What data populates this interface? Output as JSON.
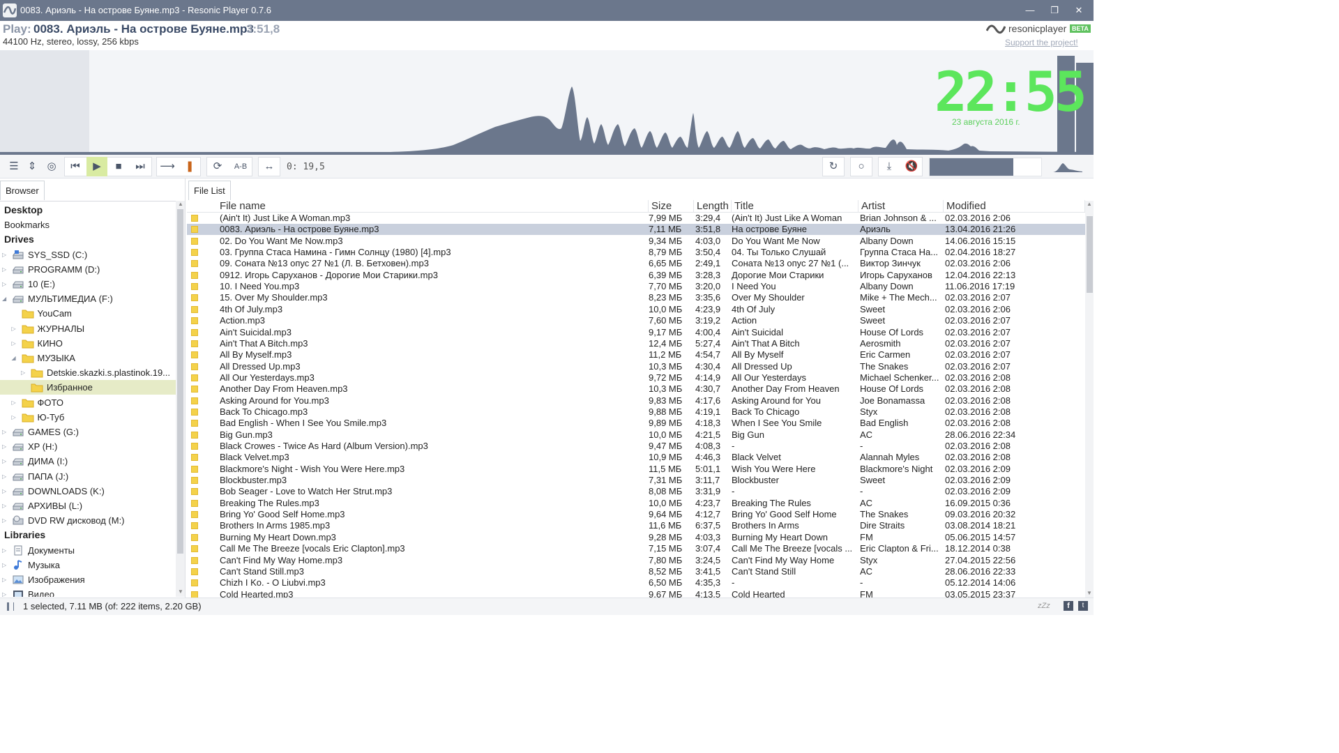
{
  "window": {
    "title": "0083. Ариэль - На острове Буяне.mp3 - Resonic Player 0.7.6",
    "min_icon": "minimize-icon",
    "max_icon": "maximize-icon",
    "close_icon": "close-icon"
  },
  "now_playing": {
    "play_label": "Play:",
    "title": "0083. Ариэль - На острове Буяне.mp3",
    "time": "3:51,8",
    "info": "44100 Hz, stereo, lossy, 256 kbps"
  },
  "brand": {
    "name": "resonicplayer",
    "beta": "BETA",
    "support": "Support the project!"
  },
  "clock": {
    "time": "22:55",
    "date": "23 августа 2016 г."
  },
  "toolbar": {
    "position_readout": "0: 19,5",
    "ab_label": "A-B",
    "volume_level": 0.75,
    "accent": "#d9eba2"
  },
  "browser": {
    "tab": "Browser",
    "tree": [
      {
        "label": "Desktop",
        "type": "section"
      },
      {
        "label": "Bookmarks",
        "type": "plain"
      },
      {
        "label": "Drives",
        "type": "section"
      },
      {
        "label": "SYS_SSD (C:)",
        "type": "drive",
        "depth": 0,
        "arrow": "right",
        "icon": "ssd-drive-icon"
      },
      {
        "label": "PROGRAMM (D:)",
        "type": "drive",
        "depth": 0,
        "arrow": "right",
        "icon": "hard-drive-icon"
      },
      {
        "label": "10 (E:)",
        "type": "drive",
        "depth": 0,
        "arrow": "right",
        "icon": "hard-drive-icon"
      },
      {
        "label": "МУЛЬТИМЕДИА (F:)",
        "type": "drive",
        "depth": 0,
        "arrow": "down",
        "icon": "hard-drive-icon"
      },
      {
        "label": "YouCam",
        "type": "folder",
        "depth": 1,
        "arrow": "",
        "icon": "folder-icon"
      },
      {
        "label": "ЖУРНАЛЫ",
        "type": "folder",
        "depth": 1,
        "arrow": "right",
        "icon": "folder-icon"
      },
      {
        "label": "КИНО",
        "type": "folder",
        "depth": 1,
        "arrow": "right",
        "icon": "folder-icon"
      },
      {
        "label": "МУЗЫКА",
        "type": "folder",
        "depth": 1,
        "arrow": "down",
        "icon": "folder-icon"
      },
      {
        "label": "Detskie.skazki.s.plastinok.19...",
        "type": "folder",
        "depth": 2,
        "arrow": "right",
        "icon": "folder-icon"
      },
      {
        "label": "Избранное",
        "type": "folder",
        "depth": 2,
        "arrow": "",
        "icon": "folder-icon",
        "selected": true
      },
      {
        "label": "ФОТО",
        "type": "folder",
        "depth": 1,
        "arrow": "right",
        "icon": "folder-icon"
      },
      {
        "label": "Ю-Туб",
        "type": "folder",
        "depth": 1,
        "arrow": "right",
        "icon": "folder-icon"
      },
      {
        "label": "GAMES (G:)",
        "type": "drive",
        "depth": 0,
        "arrow": "right",
        "icon": "hard-drive-icon"
      },
      {
        "label": "XP (H:)",
        "type": "drive",
        "depth": 0,
        "arrow": "right",
        "icon": "hard-drive-icon"
      },
      {
        "label": "ДИМА (I:)",
        "type": "drive",
        "depth": 0,
        "arrow": "right",
        "icon": "hard-drive-icon"
      },
      {
        "label": "ПАПА (J:)",
        "type": "drive",
        "depth": 0,
        "arrow": "right",
        "icon": "hard-drive-icon"
      },
      {
        "label": "DOWNLOADS (K:)",
        "type": "drive",
        "depth": 0,
        "arrow": "right",
        "icon": "hard-drive-icon"
      },
      {
        "label": "АРХИВЫ (L:)",
        "type": "drive",
        "depth": 0,
        "arrow": "right",
        "icon": "hard-drive-icon"
      },
      {
        "label": "DVD RW дисковод (M:)",
        "type": "drive",
        "depth": 0,
        "arrow": "right",
        "icon": "dvd-drive-icon"
      },
      {
        "label": "Libraries",
        "type": "section"
      },
      {
        "label": "Документы",
        "type": "drive",
        "depth": 0,
        "arrow": "right",
        "icon": "documents-icon"
      },
      {
        "label": "Музыка",
        "type": "drive",
        "depth": 0,
        "arrow": "right",
        "icon": "music-library-icon"
      },
      {
        "label": "Изображения",
        "type": "drive",
        "depth": 0,
        "arrow": "right",
        "icon": "pictures-icon"
      },
      {
        "label": "Видео",
        "type": "drive",
        "depth": 0,
        "arrow": "right",
        "icon": "video-library-icon"
      }
    ]
  },
  "filelist": {
    "tab": "File List",
    "columns": [
      "File name",
      "Size",
      "Length",
      "Title",
      "Artist",
      "Modified"
    ],
    "rows": [
      [
        "(Ain't It) Just Like A Woman.mp3",
        "7,99 МБ",
        "3:29,4",
        "(Ain't It) Just Like A Woman",
        "Brian Johnson & ...",
        "02.03.2016 2:06"
      ],
      [
        "0083. Ариэль - На острове Буяне.mp3",
        "7,11 МБ",
        "3:51,8",
        "На острове Буяне",
        "Ариэль",
        "13.04.2016 21:26"
      ],
      [
        "02. Do You Want Me Now.mp3",
        "9,34 МБ",
        "4:03,0",
        "Do You Want Me Now",
        "Albany Down",
        "14.06.2016 15:15"
      ],
      [
        "03. Группа Стаса Намина - Гимн Солнцу (1980) [4].mp3",
        "8,79 МБ",
        "3:50,4",
        "04. Ты Только Слушай",
        "Группа Стаса На...",
        "02.04.2016 18:27"
      ],
      [
        "09. Соната №13 опус 27 №1 (Л. В. Бетховен).mp3",
        "6,65 МБ",
        "2:49,1",
        "Соната №13 опус 27 №1 (...",
        "Виктор Зинчук",
        "02.03.2016 2:06"
      ],
      [
        "0912. Игорь Саруханов - Дорогие Мои Старики.mp3",
        "6,39 МБ",
        "3:28,3",
        "Дорогие Мои Старики",
        "Игорь Саруханов",
        "12.04.2016 22:13"
      ],
      [
        "10. I Need You.mp3",
        "7,70 МБ",
        "3:20,0",
        "I Need You",
        "Albany Down",
        "11.06.2016 17:19"
      ],
      [
        "15. Over My Shoulder.mp3",
        "8,23 МБ",
        "3:35,6",
        "Over My Shoulder",
        "Mike + The Mech...",
        "02.03.2016 2:07"
      ],
      [
        "4th Of July.mp3",
        "10,0 МБ",
        "4:23,9",
        "4th Of July",
        "Sweet",
        "02.03.2016 2:06"
      ],
      [
        "Action.mp3",
        "7,60 МБ",
        "3:19,2",
        "Action",
        "Sweet",
        "02.03.2016 2:07"
      ],
      [
        "Ain't Suicidal.mp3",
        "9,17 МБ",
        "4:00,4",
        "Ain't Suicidal",
        "House Of Lords",
        "02.03.2016 2:07"
      ],
      [
        "Ain't That A Bitch.mp3",
        "12,4 МБ",
        "5:27,4",
        "Ain't That A Bitch",
        "Aerosmith",
        "02.03.2016 2:07"
      ],
      [
        "All By Myself.mp3",
        "11,2 МБ",
        "4:54,7",
        "All By Myself",
        "Eric Carmen",
        "02.03.2016 2:07"
      ],
      [
        "All Dressed Up.mp3",
        "10,3 МБ",
        "4:30,4",
        "All Dressed Up",
        "The Snakes",
        "02.03.2016 2:07"
      ],
      [
        "All Our Yesterdays.mp3",
        "9,72 МБ",
        "4:14,9",
        " All Our Yesterdays",
        "Michael Schenker...",
        "02.03.2016 2:08"
      ],
      [
        "Another Day From Heaven.mp3",
        "10,3 МБ",
        "4:30,7",
        "Another Day From Heaven",
        "House Of Lords",
        "02.03.2016 2:08"
      ],
      [
        "Asking Around for You.mp3",
        "9,83 МБ",
        "4:17,6",
        "Asking Around for You",
        "Joe Bonamassa",
        "02.03.2016 2:08"
      ],
      [
        "Back To Chicago.mp3",
        "9,88 МБ",
        "4:19,1",
        "Back To Chicago",
        "Styx",
        "02.03.2016 2:08"
      ],
      [
        "Bad English - When I See You Smile.mp3",
        "9,89 МБ",
        "4:18,3",
        "When I See You Smile",
        "Bad English",
        "02.03.2016 2:08"
      ],
      [
        "Big Gun.mp3",
        "10,0 МБ",
        "4:21,5",
        "Big Gun",
        "AC",
        "28.06.2016 22:34"
      ],
      [
        "Black Crowes - Twice As Hard (Album Version).mp3",
        "9,47 МБ",
        "4:08,3",
        "-",
        "-",
        "02.03.2016 2:08"
      ],
      [
        "Black Velvet.mp3",
        "10,9 МБ",
        "4:46,3",
        "Black Velvet",
        "Alannah Myles",
        "02.03.2016 2:08"
      ],
      [
        "Blackmore's Night - Wish You Were Here.mp3",
        "11,5 МБ",
        "5:01,1",
        "Wish You Were Here",
        "Blackmore's Night",
        "02.03.2016 2:09"
      ],
      [
        "Blockbuster.mp3",
        "7,31 МБ",
        "3:11,7",
        "Blockbuster",
        "Sweet",
        "02.03.2016 2:09"
      ],
      [
        "Bob Seager - Love to Watch Her Strut.mp3",
        "8,08 МБ",
        "3:31,9",
        "-",
        "-",
        "02.03.2016 2:09"
      ],
      [
        "Breaking The Rules.mp3",
        "10,0 МБ",
        "4:23,7",
        "Breaking The Rules",
        "AC",
        "16.09.2015 0:36"
      ],
      [
        "Bring Yo' Good Self Home.mp3",
        "9,64 МБ",
        "4:12,7",
        "Bring Yo' Good Self Home",
        "The Snakes",
        "09.03.2016 20:32"
      ],
      [
        "Brothers In Arms 1985.mp3",
        "11,6 МБ",
        "6:37,5",
        "Brothers In Arms",
        "Dire Straits",
        "03.08.2014 18:21"
      ],
      [
        "Burning My Heart Down.mp3",
        "9,28 МБ",
        "4:03,3",
        "Burning My Heart Down",
        "FM",
        "05.06.2015 14:57"
      ],
      [
        "Call Me The Breeze [vocals Eric Clapton].mp3",
        "7,15 МБ",
        "3:07,4",
        "Call Me The Breeze [vocals ...",
        "Eric Clapton & Fri...",
        "18.12.2014 0:38"
      ],
      [
        "Can't Find My Way Home.mp3",
        "7,80 МБ",
        "3:24,5",
        "Can't Find My Way Home",
        "Styx",
        "27.04.2015 22:56"
      ],
      [
        "Can't Stand Still.mp3",
        "8,52 МБ",
        "3:41,5",
        "Can't Stand Still",
        "AC",
        "28.06.2016 22:33"
      ],
      [
        "Chizh I Ko. - O Liubvi.mp3",
        "6,50 МБ",
        "4:35,3",
        "-",
        "-",
        "05.12.2014 14:06"
      ],
      [
        "Cold Hearted.mp3",
        "9,67 МБ",
        "4:13,5",
        "Cold Hearted",
        "FM",
        "03.05.2015 23:37"
      ]
    ],
    "selected_index": 1
  },
  "statusbar": {
    "text": "1 selected, 7.11 MB (of: 222 items, 2.20 GB)",
    "sleep": "zZz"
  }
}
